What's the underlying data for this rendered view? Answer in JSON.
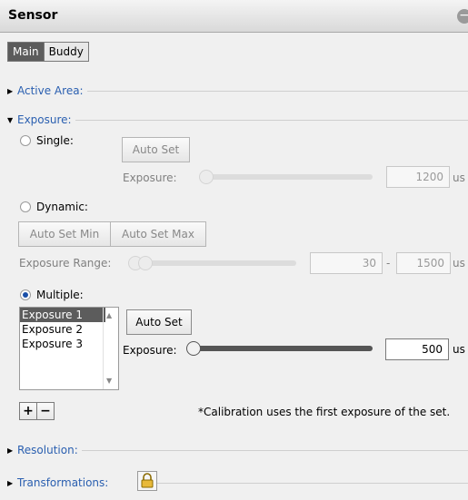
{
  "panel": {
    "title": "Sensor",
    "collapse_icon": "minus"
  },
  "tabs": [
    {
      "label": "Main",
      "active": true
    },
    {
      "label": "Buddy",
      "active": false
    }
  ],
  "sections": {
    "active_area": "Active Area:",
    "exposure": "Exposure:",
    "resolution": "Resolution:",
    "transformations": "Transformations:"
  },
  "single": {
    "label": "Single:",
    "selected": false,
    "auto_set": "Auto Set",
    "exposure_label": "Exposure:",
    "value": "1200",
    "unit": "us"
  },
  "dynamic": {
    "label": "Dynamic:",
    "selected": false,
    "auto_set_min": "Auto Set Min",
    "auto_set_max": "Auto Set Max",
    "range_label": "Exposure Range:",
    "min": "30",
    "dash": "-",
    "max": "1500",
    "unit": "us"
  },
  "multiple": {
    "label": "Multiple:",
    "selected": true,
    "list": [
      "Exposure 1",
      "Exposure 2",
      "Exposure 3"
    ],
    "selected_index": 0,
    "auto_set": "Auto Set",
    "exposure_label": "Exposure:",
    "value": "500",
    "unit": "us",
    "add": "+",
    "remove": "−",
    "note": "*Calibration uses the first exposure of the set."
  },
  "colors": {
    "accent": "#2a5fb0",
    "selected": "#5c5c5c"
  }
}
